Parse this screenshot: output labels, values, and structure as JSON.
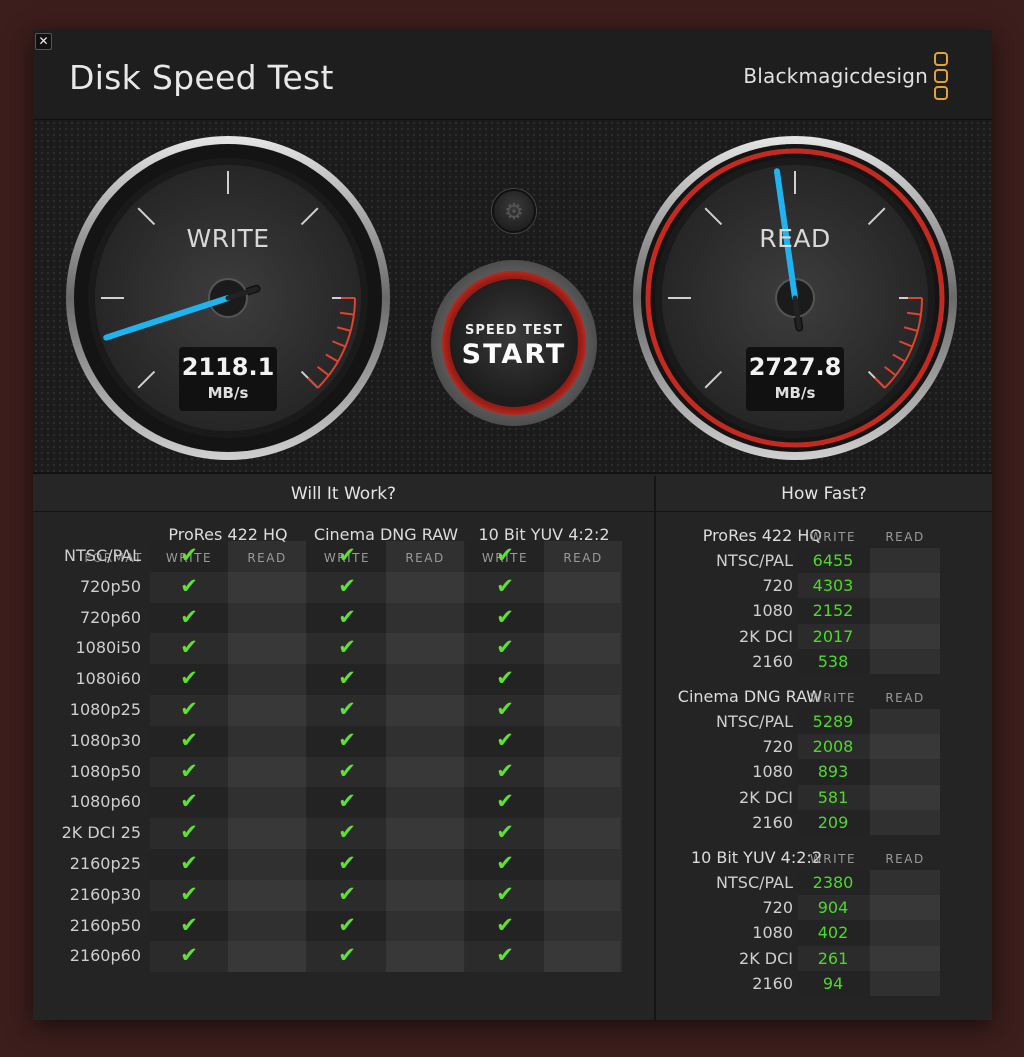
{
  "window": {
    "title": "Disk Speed Test",
    "brand": "Blackmagicdesign",
    "close_glyph": "✕"
  },
  "gauges": {
    "write": {
      "label": "WRITE",
      "value": "2118.1",
      "unit": "MB/s",
      "needle_fraction": 0.1
    },
    "read": {
      "label": "READ",
      "value": "2727.8",
      "unit": "MB/s",
      "needle_fraction": 0.47
    }
  },
  "controls": {
    "settings_icon": "gear-icon",
    "start_small": "SPEED TEST",
    "start_big": "START"
  },
  "colors": {
    "accent_red": "#d8392a",
    "needle_blue": "#1fb4f0",
    "check_green": "#5ee22e",
    "value_green": "#4dd82a",
    "brand_orange": "#e8a030"
  },
  "will_it_work": {
    "title": "Will It Work?",
    "format_header": "FORMAT",
    "codecs": [
      {
        "name": "ProRes 422 HQ",
        "write": "WRITE",
        "read": "READ"
      },
      {
        "name": "Cinema DNG RAW",
        "write": "WRITE",
        "read": "READ"
      },
      {
        "name": "10 Bit YUV 4:2:2",
        "write": "WRITE",
        "read": "READ"
      }
    ],
    "check_glyph": "✔",
    "rows": [
      {
        "format": "NTSC/PAL"
      },
      {
        "format": "720p50"
      },
      {
        "format": "720p60"
      },
      {
        "format": "1080i50"
      },
      {
        "format": "1080i60"
      },
      {
        "format": "1080p25"
      },
      {
        "format": "1080p30"
      },
      {
        "format": "1080p50"
      },
      {
        "format": "1080p60"
      },
      {
        "format": "2K DCI 25"
      },
      {
        "format": "2160p25"
      },
      {
        "format": "2160p30"
      },
      {
        "format": "2160p50"
      },
      {
        "format": "2160p60"
      }
    ]
  },
  "how_fast": {
    "title": "How Fast?",
    "groups": [
      {
        "name": "ProRes 422 HQ",
        "write": "WRITE",
        "read": "READ",
        "rows": [
          {
            "label": "NTSC/PAL",
            "write": "6455"
          },
          {
            "label": "720",
            "write": "4303"
          },
          {
            "label": "1080",
            "write": "2152"
          },
          {
            "label": "2K DCI",
            "write": "2017"
          },
          {
            "label": "2160",
            "write": "538"
          }
        ]
      },
      {
        "name": "Cinema DNG RAW",
        "write": "WRITE",
        "read": "READ",
        "rows": [
          {
            "label": "NTSC/PAL",
            "write": "5289"
          },
          {
            "label": "720",
            "write": "2008"
          },
          {
            "label": "1080",
            "write": "893"
          },
          {
            "label": "2K DCI",
            "write": "581"
          },
          {
            "label": "2160",
            "write": "209"
          }
        ]
      },
      {
        "name": "10 Bit YUV 4:2:2",
        "write": "WRITE",
        "read": "READ",
        "rows": [
          {
            "label": "NTSC/PAL",
            "write": "2380"
          },
          {
            "label": "720",
            "write": "904"
          },
          {
            "label": "1080",
            "write": "402"
          },
          {
            "label": "2K DCI",
            "write": "261"
          },
          {
            "label": "2160",
            "write": "94"
          }
        ]
      }
    ]
  }
}
